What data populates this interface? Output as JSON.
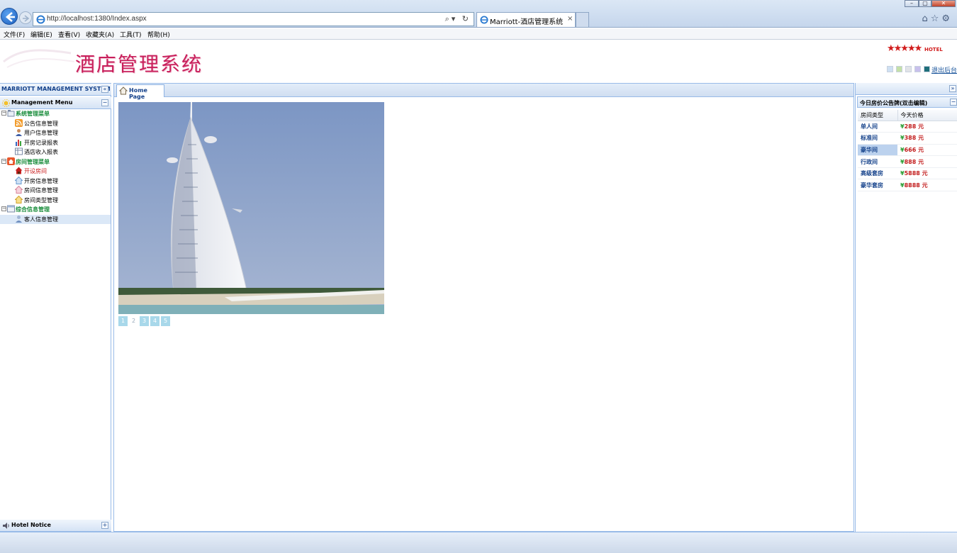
{
  "browser": {
    "url": "http://localhost:1380/Index.aspx",
    "tab_title": "Marriott-酒店管理系统",
    "tab_close": "×",
    "address_tools": "⌕▾ ↻",
    "window_buttons": [
      "–",
      "▢",
      "✕"
    ],
    "right_icons": "⌂☆⚙"
  },
  "menubar": {
    "items": [
      "文件(F)",
      "编辑(E)",
      "查看(V)",
      "收藏夹(A)",
      "工具(T)",
      "帮助(H)"
    ]
  },
  "header": {
    "site_title": "酒店管理系统",
    "stars": "★★★★★",
    "hotel_label": "HOTEL",
    "logout_label": "退出后台",
    "swatch_colors": [
      "#cfe0f3",
      "#c4e0a8",
      "#e2e4e8",
      "#c8c0ec",
      "#1e6f7a"
    ]
  },
  "left_panel": {
    "system_title": "MARRIOTT MANAGEMENT SYSTEM",
    "collapse_glyph": "«",
    "menu_title": "Management Menu",
    "menu_toggle": "−",
    "tree": [
      {
        "label": "系统管理菜单",
        "kind": "group",
        "toggle": "−",
        "icon": "folder-icon"
      },
      {
        "label": "公告信息管理",
        "kind": "leaf",
        "icon": "rss-icon"
      },
      {
        "label": "用户信息管理",
        "kind": "leaf",
        "icon": "user-icon"
      },
      {
        "label": "开房记录报表",
        "kind": "leaf",
        "icon": "bar-chart-icon"
      },
      {
        "label": "酒店收入报表",
        "kind": "leaf",
        "icon": "table-icon"
      },
      {
        "label": "房间管理菜单",
        "kind": "group",
        "toggle": "−",
        "icon": "home-icon"
      },
      {
        "label": "开设房间",
        "kind": "red",
        "icon": "house-icon"
      },
      {
        "label": "开房信息管理",
        "kind": "leaf",
        "icon": "house-blue-icon"
      },
      {
        "label": "房间信息管理",
        "kind": "leaf",
        "icon": "house-pink-icon"
      },
      {
        "label": "房间类型管理",
        "kind": "leaf",
        "icon": "house-yellow-icon"
      },
      {
        "label": "综合信息管理",
        "kind": "group",
        "toggle": "−",
        "icon": "window-icon"
      },
      {
        "label": "客人信息管理",
        "kind": "leaf",
        "icon": "guest-icon",
        "selected": true
      }
    ],
    "notice_title": "Hotel Notice",
    "notice_toggle": "+"
  },
  "center": {
    "home_tab_label": "Home Page",
    "pager": [
      "1",
      "2",
      "3",
      "4",
      "5"
    ],
    "active_page": "2"
  },
  "right_panel": {
    "expand_glyph": "»",
    "price_title": "今日房价公告牌(双击编辑)",
    "price_toggle": "−",
    "columns": [
      "房间类型",
      "今天价格"
    ],
    "rows": [
      {
        "type": "单人间",
        "price": "288",
        "unit": "元"
      },
      {
        "type": "标准间",
        "price": "388",
        "unit": "元"
      },
      {
        "type": "豪华间",
        "price": "666",
        "unit": "元",
        "selected": true
      },
      {
        "type": "行政间",
        "price": "888",
        "unit": "元"
      },
      {
        "type": "高级套房",
        "price": "5888",
        "unit": "元"
      },
      {
        "type": "豪华套房",
        "price": "8888",
        "unit": "元"
      }
    ],
    "currency": "¥"
  }
}
